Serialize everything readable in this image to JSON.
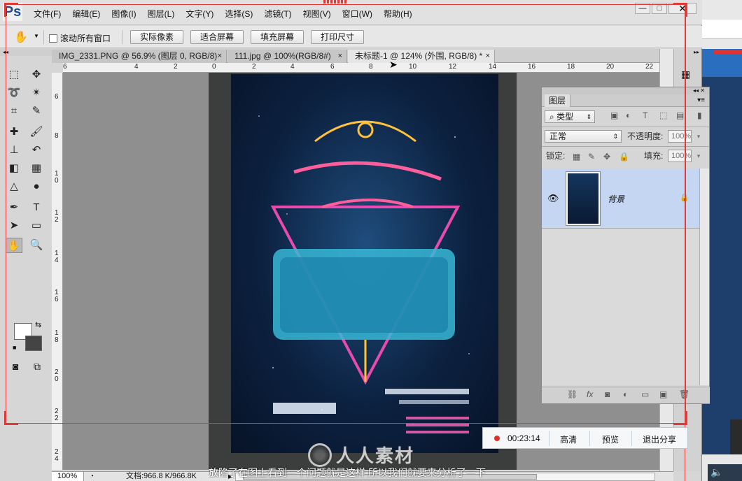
{
  "app": {
    "logo": "Ps",
    "menu": [
      "文件(F)",
      "编辑(E)",
      "图像(I)",
      "图层(L)",
      "文字(Y)",
      "选择(S)",
      "滤镜(T)",
      "视图(V)",
      "窗口(W)",
      "帮助(H)"
    ],
    "window_controls": {
      "minimize": "—",
      "maximize": "□",
      "close": "✕"
    }
  },
  "options_bar": {
    "scroll_all_windows": "滚动所有窗口",
    "buttons": [
      "实际像素",
      "适合屏幕",
      "填充屏幕",
      "打印尺寸"
    ]
  },
  "documents": {
    "tabs": [
      {
        "title": "IMG_2331.PNG @ 56.9% (图层 0, RGB/8)",
        "active": false
      },
      {
        "title": "111.jpg @ 100%(RGB/8#)",
        "active": false
      },
      {
        "title": "未标题-1 @ 124% (外围, RGB/8) *",
        "active": true
      }
    ],
    "close_glyph": "×"
  },
  "rulers": {
    "horizontal": [
      "6",
      "4",
      "2",
      "0",
      "2",
      "4",
      "6",
      "8",
      "10",
      "12",
      "14",
      "16",
      "18",
      "20",
      "22"
    ],
    "vertical": [
      "6",
      "8",
      "1 0",
      "1 2",
      "1 4",
      "1 6",
      "1 8",
      "2 0",
      "2 2",
      "2 4"
    ]
  },
  "status": {
    "zoom": "100%",
    "doc_info": "文档:966.8 K/966.8K"
  },
  "layers_panel": {
    "tab": "图层",
    "filter_type": "类型",
    "blend_mode": "正常",
    "opacity_label": "不透明度:",
    "opacity_value": "100%",
    "lock_label": "锁定:",
    "fill_label": "填充:",
    "fill_value": "100%",
    "layer": {
      "name": "背景",
      "visible": true,
      "locked": true
    }
  },
  "share_bar": {
    "timer": "00:23:14",
    "buttons": [
      "高清",
      "预览",
      "退出分享"
    ]
  },
  "overlay": {
    "subtitle": "放陷了在图上看到一个问题就是这样 所以我们就要来分析了一下",
    "watermark": "人人素材"
  },
  "colors": {
    "record_red": "#e13838",
    "selected_layer": "#c4d6f2",
    "ps_blue": "#1d4f91"
  }
}
